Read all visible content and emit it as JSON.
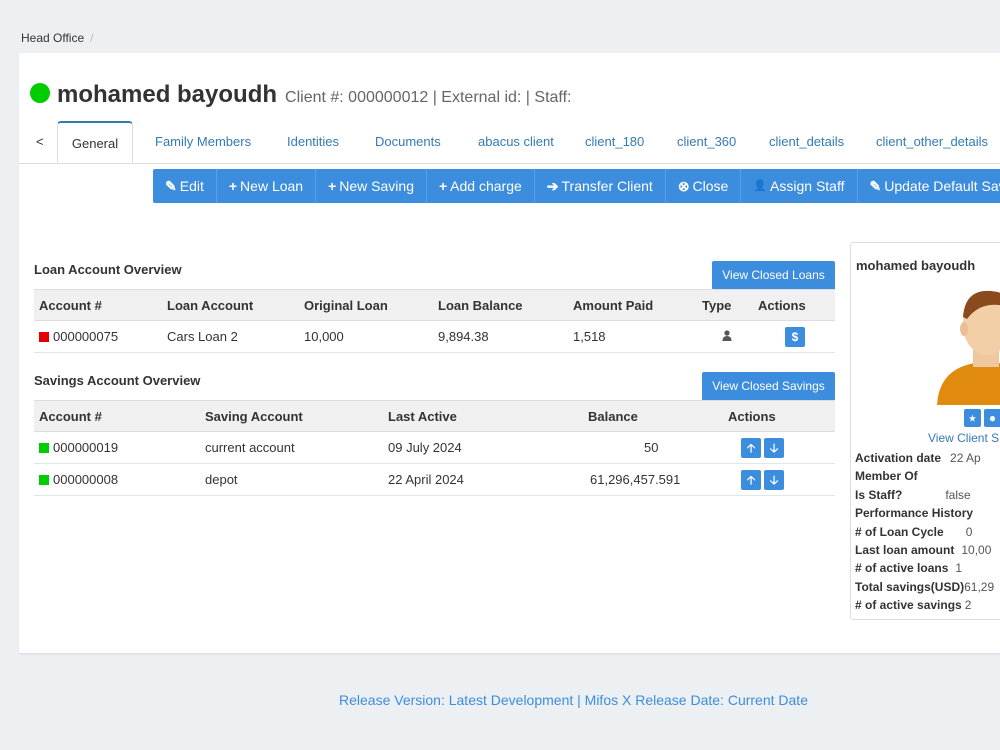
{
  "breadcrumb": {
    "office": "Head Office",
    "separator": "/"
  },
  "client": {
    "name": "mohamed bayoudh",
    "meta": "Client #: 000000012 | External id: | Staff:",
    "status_color": "#00cc00"
  },
  "tabs": [
    {
      "label": "<"
    },
    {
      "label": "General"
    },
    {
      "label": "Family Members"
    },
    {
      "label": "Identities"
    },
    {
      "label": "Documents"
    },
    {
      "label": "abacus client"
    },
    {
      "label": "client_180"
    },
    {
      "label": "client_360"
    },
    {
      "label": "client_details"
    },
    {
      "label": "client_other_details"
    }
  ],
  "toolbar": [
    {
      "icon": "✎",
      "label": "Edit"
    },
    {
      "icon": "+",
      "label": "New Loan"
    },
    {
      "icon": "+",
      "label": "New Saving"
    },
    {
      "icon": "+",
      "label": "Add charge"
    },
    {
      "icon": "➔",
      "label": "Transfer Client"
    },
    {
      "icon": "⊗",
      "label": "Close"
    },
    {
      "icon": "👤",
      "label": "Assign Staff"
    },
    {
      "icon": "✎",
      "label": "Update Default Saving"
    }
  ],
  "loans": {
    "title": "Loan Account Overview",
    "closed_button": "View Closed Loans",
    "headers": [
      "Account #",
      "Loan Account",
      "Original Loan",
      "Loan Balance",
      "Amount Paid",
      "Type",
      "Actions"
    ],
    "rows": [
      {
        "account": "000000075",
        "product": "Cars Loan 2",
        "original": "10,000",
        "balance": "9,894.38",
        "paid": "1,518",
        "status_color": "#e50000",
        "type_icon": "person-icon",
        "action": "$"
      }
    ]
  },
  "savings": {
    "title": "Savings Account Overview",
    "closed_button": "View Closed Savings",
    "headers": [
      "Account #",
      "Saving Account",
      "Last Active",
      "Balance",
      "Actions"
    ],
    "rows": [
      {
        "account": "000000019",
        "product": "current account",
        "last_active": "09 July 2024",
        "balance": "50",
        "status_color": "#00cc00"
      },
      {
        "account": "000000008",
        "product": "depot",
        "last_active": "22 April 2024",
        "balance": "61,296,457.591",
        "status_color": "#00cc00"
      }
    ]
  },
  "side": {
    "name": "mohamed bayoudh",
    "view_link": "View Client S",
    "details": [
      {
        "label": "Activation date",
        "value": "22 Ap"
      },
      {
        "label": "Member Of",
        "value": ""
      },
      {
        "label": "Is Staff?",
        "value": "false"
      },
      {
        "label": "Performance History",
        "value": ""
      },
      {
        "label": "# of Loan Cycle",
        "value": "0"
      },
      {
        "label": "Last loan amount",
        "value": "10,00"
      },
      {
        "label": "# of active loans",
        "value": "1"
      },
      {
        "label": "Total savings(USD)",
        "value": "61,29"
      },
      {
        "label": "# of active savings",
        "value": "2"
      }
    ]
  },
  "footer": "Release Version: Latest Development | Mifos X Release Date: Current Date"
}
